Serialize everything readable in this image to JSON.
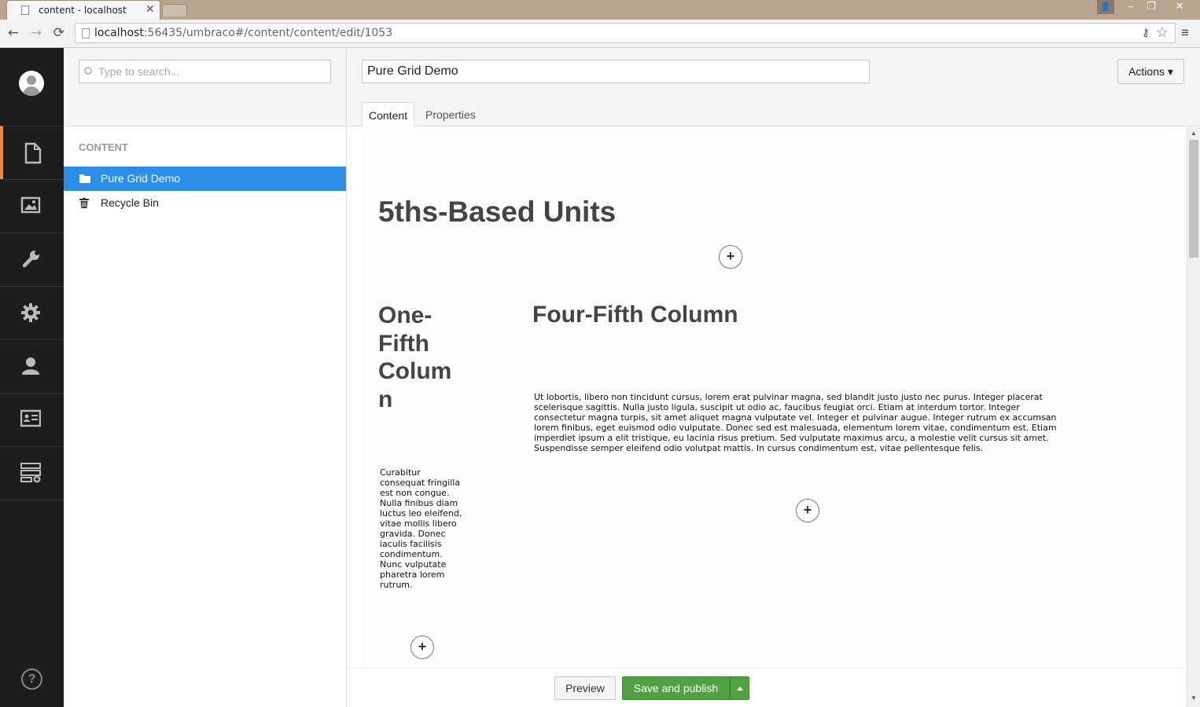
{
  "browser": {
    "tab_title": "content - localhost",
    "tab_close": "✕",
    "url_host": "localhost",
    "url_path": ":56435/umbraco#/content/content/edit/1053",
    "window_user": "👤",
    "minimize": "–",
    "restore": "❐",
    "close": "✕",
    "back": "←",
    "forward": "→",
    "reload": "⟳",
    "key": "⚷",
    "star": "☆",
    "menu": "≡"
  },
  "leftnav": {
    "sections": [
      "content",
      "media",
      "settings",
      "developer",
      "users",
      "members",
      "forms"
    ],
    "active": "content",
    "help": "?"
  },
  "tree": {
    "search_placeholder": "Type to search...",
    "heading": "CONTENT",
    "items": [
      {
        "label": "Pure Grid Demo",
        "icon": "folder-icon",
        "selected": true
      },
      {
        "label": "Recycle Bin",
        "icon": "trash-icon",
        "selected": false
      }
    ]
  },
  "editor": {
    "name_value": "Pure Grid Demo",
    "actions_label": "Actions ▾",
    "tabs": [
      {
        "label": "Content",
        "active": true
      },
      {
        "label": "Properties",
        "active": false
      }
    ]
  },
  "grid": {
    "section_title": "5ths-Based Units",
    "plus": "+",
    "col1_title": "One-Fifth Column",
    "col1_title_lines": [
      "One-",
      "Fifth",
      "Colum",
      "n"
    ],
    "col1_text_lines": [
      "Curabitur",
      "consequat fringilla",
      "est non congue.",
      "Nulla finibus diam",
      "luctus leo eleifend,",
      "vitae mollis libero",
      "gravida. Donec",
      "iaculis facilisis",
      "condimentum.",
      "Nunc vulputate",
      "pharetra lorem",
      "rutrum."
    ],
    "col2_title": "Four-Fifth Column",
    "col2_text_lines": [
      "Ut lobortis, libero non tincidunt cursus, lorem erat pulvinar magna, sed blandit justo justo nec purus. Integer placerat",
      "scelerisque sagittis. Nulla justo ligula, suscipit ut odio ac, faucibus feugiat orci. Etiam at interdum tortor. Integer",
      "consectetur magna turpis, sit amet aliquet magna vulputate vel. Integer et pulvinar augue. Integer rutrum ex accumsan",
      "lorem finibus, eget euismod odio vulputate. Donec sed est malesuada, elementum lorem vitae, condimentum est. Etiam",
      "imperdiet ipsum a elit tristique, eu lacinia risus pretium. Sed vulputate maximus arcu, a molestie velit cursus sit amet.",
      "Suspendisse semper eleifend odio volutpat mattis. In cursus condimentum est, vitae pellentesque felis."
    ]
  },
  "footer": {
    "preview_label": "Preview",
    "publish_label": "Save and publish"
  },
  "colors": {
    "accent_orange": "#f5883b",
    "selection_blue": "#2d8ee8",
    "publish_green": "#50a13f",
    "nav_dark": "#1d1d1d"
  }
}
